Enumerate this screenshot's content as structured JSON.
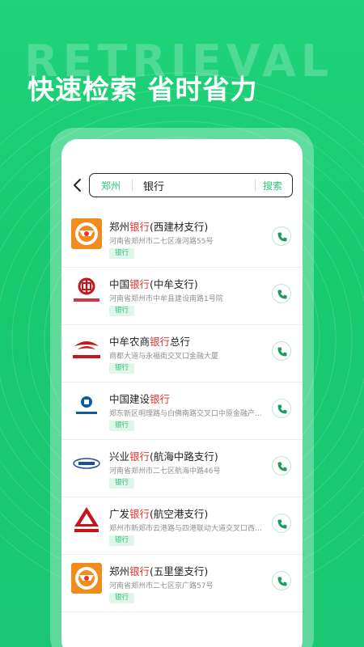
{
  "banner": {
    "bg_word": "RETRIEVAL",
    "headline": "快速检索 省时省力"
  },
  "search": {
    "city": "郑州",
    "query": "银行",
    "button": "搜索"
  },
  "colors": {
    "brand_green": "#1fd37a",
    "accent_green": "#2cc377",
    "highlight_red": "#e8332b"
  },
  "results": [
    {
      "name_prefix": "郑州",
      "name_hl": "银行",
      "name_suffix": "(西建材支行)",
      "address": "河南省郑州市二七区淮河路55号",
      "tag": "银行",
      "logo": "zhengzhou-bank-logo-icon"
    },
    {
      "name_prefix": "中国",
      "name_hl": "银行",
      "name_suffix": "(中牟支行)",
      "address": "河南省郑州市中牟县建设南路1号院",
      "tag": "银行",
      "logo": "bank-of-china-logo-icon"
    },
    {
      "name_prefix": "中牟农商",
      "name_hl": "银行",
      "name_suffix": "总行",
      "address": "商都大道与永福街交叉口金融大厦",
      "tag": "银行",
      "logo": "zhongmu-rural-bank-logo-icon"
    },
    {
      "name_prefix": "中国建设",
      "name_hl": "银行",
      "name_suffix": "",
      "address": "郑东新区明理路与白佛南路交叉口中原金融产…",
      "tag": "银行",
      "logo": "ccb-logo-icon"
    },
    {
      "name_prefix": "兴业",
      "name_hl": "银行",
      "name_suffix": "(航海中路支行)",
      "address": "河南省郑州市二七区航海中路46号",
      "tag": "银行",
      "logo": "industrial-bank-logo-icon"
    },
    {
      "name_prefix": "广发",
      "name_hl": "银行",
      "name_suffix": "(航空港支行)",
      "address": "郑州市新郑市云港路与四港联动大道交叉口西…",
      "tag": "银行",
      "logo": "cgb-logo-icon"
    },
    {
      "name_prefix": "郑州",
      "name_hl": "银行",
      "name_suffix": "(五里堡支行)",
      "address": "河南省郑州市二七区京广路57号",
      "tag": "银行",
      "logo": "zhengzhou-bank-logo-icon"
    }
  ]
}
